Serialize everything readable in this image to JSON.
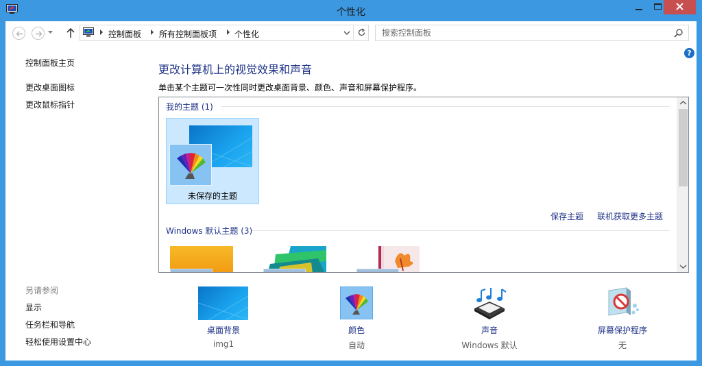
{
  "window": {
    "title": "个性化",
    "app_icon": "personalization-icon",
    "controls": {
      "minimize": "minimize-icon",
      "maximize": "maximize-icon",
      "close": "close-icon"
    }
  },
  "nav": {
    "back_icon": "back-arrow-icon",
    "forward_icon": "forward-arrow-icon",
    "up_icon": "up-arrow-icon",
    "breadcrumb": [
      "控制面板",
      "所有控制面板项",
      "个性化"
    ],
    "refresh_icon": "refresh-icon",
    "search_placeholder": "搜索控制面板",
    "search_icon": "search-icon"
  },
  "help_label": "?",
  "sidebar": {
    "home": "控制面板主页",
    "links": [
      "更改桌面图标",
      "更改鼠标指针"
    ],
    "see_also_title": "另请参阅",
    "see_also": [
      "显示",
      "任务栏和导航",
      "轻松使用设置中心"
    ]
  },
  "main": {
    "title": "更改计算机上的视觉效果和声音",
    "description": "单击某个主题可一次性同时更改桌面背景、颜色、声音和屏幕保护程序。",
    "my_themes_header": "我的主题 (1)",
    "unsaved_theme_label": "未保存的主题",
    "save_theme_link": "保存主题",
    "get_more_link": "联机获取更多主题",
    "default_themes_header": "Windows 默认主题 (3)"
  },
  "settings": [
    {
      "name": "桌面背景",
      "value": "img1",
      "icon": "desktop-background-icon"
    },
    {
      "name": "颜色",
      "value": "自动",
      "icon": "color-palette-icon"
    },
    {
      "name": "声音",
      "value": "Windows 默认",
      "icon": "sound-icon"
    },
    {
      "name": "屏幕保护程序",
      "value": "无",
      "icon": "screen-saver-icon"
    }
  ],
  "colors": {
    "frame": "#3c98e0",
    "link": "#1e3287",
    "close_button": "#c74f4f",
    "selected_tile": "#cce8ff"
  }
}
